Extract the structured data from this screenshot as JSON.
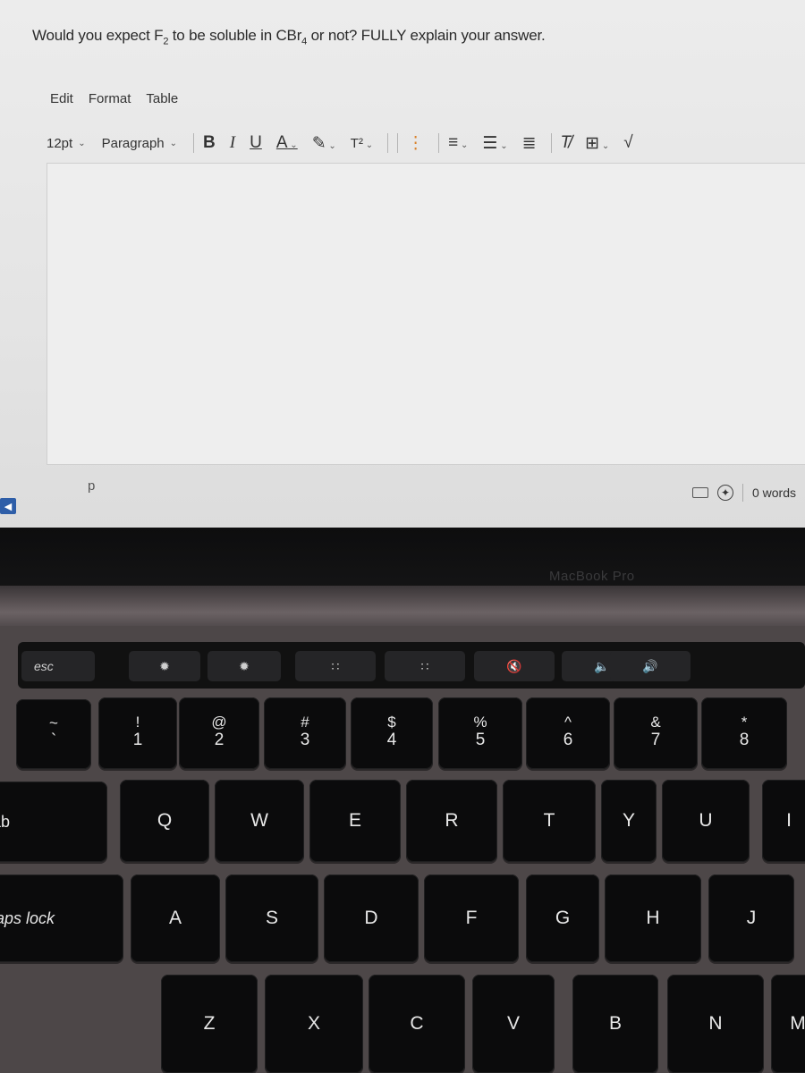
{
  "question": {
    "prefix": "Would you expect F",
    "sub1": "2",
    "mid": " to be soluble in CBr",
    "sub2": "4",
    "suffix": " or not? FULLY explain your answer."
  },
  "menubar": [
    "Edit",
    "Format",
    "Table"
  ],
  "toolbar": {
    "font_size": "12pt",
    "block_format": "Paragraph",
    "bold": "B",
    "italic": "I",
    "underline": "U",
    "text_color": "A",
    "highlight": "✎",
    "superscript": "T²",
    "more": "⋮",
    "align": "≡",
    "list": "☰",
    "indent": "≣",
    "clear_format": "T̸",
    "table": "⊞",
    "formula": "√"
  },
  "editor": {
    "content": ""
  },
  "statusbar": {
    "path": "p",
    "word_count": "0 words"
  },
  "laptop": {
    "brand_label": "MacBook Pro"
  },
  "touchbar": [
    {
      "label": "esc",
      "icon": "esc"
    },
    {
      "label": "✹",
      "icon": "brightness-down-icon"
    },
    {
      "label": "✹",
      "icon": "brightness-up-icon"
    },
    {
      "label": "∷",
      "icon": "keyboard-light-down-icon"
    },
    {
      "label": "∷",
      "icon": "keyboard-light-up-icon"
    },
    {
      "label": "🔇",
      "icon": "mute-icon"
    },
    {
      "label": "🔈",
      "icon": "volume-down-icon"
    },
    {
      "label": "🔊",
      "icon": "volume-up-icon"
    }
  ],
  "keys": {
    "number_row": [
      {
        "top": "~",
        "bot": "`"
      },
      {
        "top": "!",
        "bot": "1"
      },
      {
        "top": "@",
        "bot": "2"
      },
      {
        "top": "#",
        "bot": "3"
      },
      {
        "top": "$",
        "bot": "4"
      },
      {
        "top": "%",
        "bot": "5"
      },
      {
        "top": "^",
        "bot": "6"
      },
      {
        "top": "&",
        "bot": "7"
      },
      {
        "top": "*",
        "bot": "8"
      }
    ],
    "qwerty_row": [
      "tab",
      "Q",
      "W",
      "E",
      "R",
      "T",
      "Y",
      "U",
      "I"
    ],
    "home_row": [
      "caps lock",
      "A",
      "S",
      "D",
      "F",
      "G",
      "H",
      "J"
    ],
    "bottom_row": [
      "Z",
      "X",
      "C",
      "V",
      "B",
      "N",
      "M"
    ]
  }
}
